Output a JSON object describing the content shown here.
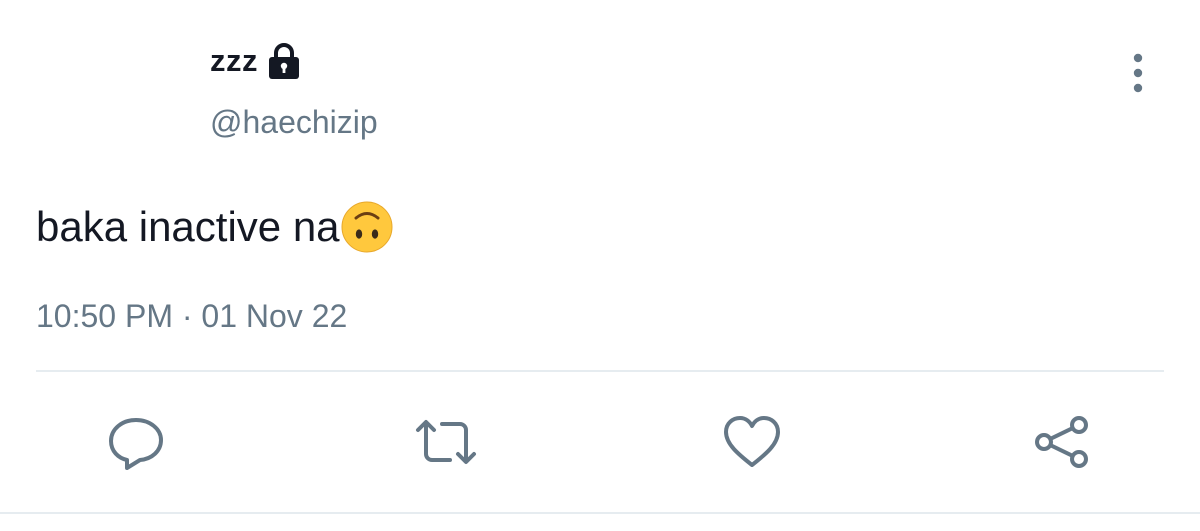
{
  "tweet": {
    "display_name": "zzz",
    "handle": "@haechizip",
    "text": "baka inactive na",
    "timestamp": "10:50 PM · 01 Nov 22"
  },
  "icons": {
    "lock": "lock-icon",
    "more": "more-vertical-icon",
    "emoji": "upside-down-face-emoji",
    "reply": "reply-icon",
    "retweet": "retweet-icon",
    "like": "heart-icon",
    "share": "share-icon"
  },
  "colors": {
    "text_primary": "#141823",
    "text_secondary": "#657786",
    "icon": "#657786",
    "divider": "#e6ecf0",
    "emoji_face": "#FFC83D"
  }
}
